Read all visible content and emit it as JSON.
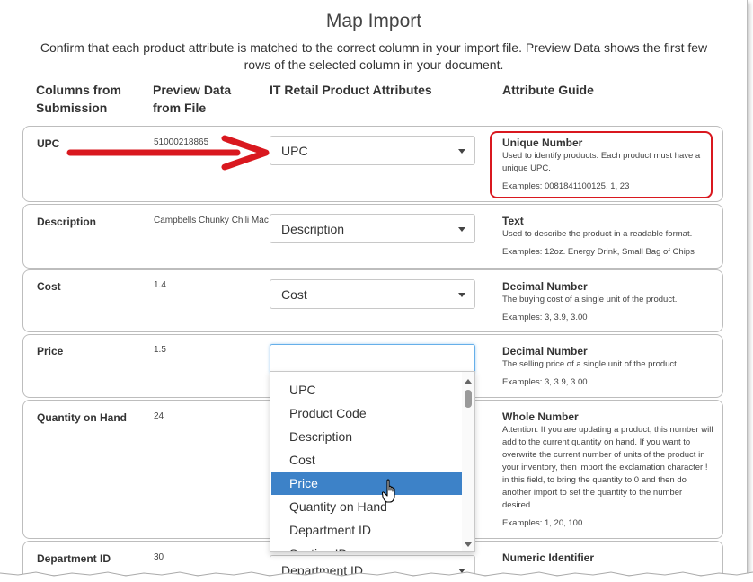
{
  "page": {
    "title": "Map Import",
    "subtitle": "Confirm that each product attribute is matched to the correct column in your import file. Preview Data shows the first few rows of the selected column in your document."
  },
  "columns": {
    "submission_line1": "Columns from",
    "submission_line2": "Submission",
    "preview_line1": "Preview Data",
    "preview_line2": "from File",
    "attributes": "IT Retail Product Attributes",
    "guide": "Attribute Guide"
  },
  "rows": [
    {
      "label": "UPC",
      "preview": "51000218865",
      "selected": "UPC",
      "guide_title": "Unique Number",
      "guide_desc": "Used to identify products. Each product must have a unique UPC.",
      "guide_example": "Examples: 0081841100125, 1, 23"
    },
    {
      "label": "Description",
      "preview": "Campbells Chunky Chili Mac,",
      "selected": "Description",
      "guide_title": "Text",
      "guide_desc": "Used to describe the product in a readable format.",
      "guide_example": "Examples: 12oz. Energy Drink, Small Bag of Chips"
    },
    {
      "label": "Cost",
      "preview": "1.4",
      "selected": "Cost",
      "guide_title": "Decimal Number",
      "guide_desc": "The buying cost of a single unit of the product.",
      "guide_example": "Examples: 3, 3.9, 3.00"
    },
    {
      "label": "Price",
      "preview": "1.5",
      "selected": "",
      "guide_title": "Decimal Number",
      "guide_desc": "The selling price of a single unit of the product.",
      "guide_example": "Examples: 3, 3.9, 3.00"
    },
    {
      "label": "Quantity on Hand",
      "preview": "24",
      "selected": "",
      "guide_title": "Whole Number",
      "guide_desc": "Attention: If you are updating a product, this number will add to the current quantity on hand. If you want to overwrite the current number of units of the product in your inventory, then import the exclamation character ! in this field, to bring the quantity to 0 and then do another import to set the quantity to the number desired.",
      "guide_example": "Examples: 1, 20, 100"
    },
    {
      "label": "Department ID",
      "preview": "30",
      "selected": "Department ID",
      "guide_title": "Numeric Identifier",
      "guide_desc": "",
      "guide_example": ""
    }
  ],
  "dropdown": {
    "options": [
      "UPC",
      "Product Code",
      "Description",
      "Cost",
      "Price",
      "Quantity on Hand",
      "Department ID",
      "Section ID"
    ],
    "highlighted": "Price"
  },
  "colors": {
    "annotation_red": "#d9181f",
    "highlight_blue": "#3d82c8",
    "focus_blue": "#66afe9"
  },
  "annotations": {
    "arrow_icon": "red-arrow-right",
    "cursor_icon": "hand-pointer"
  }
}
